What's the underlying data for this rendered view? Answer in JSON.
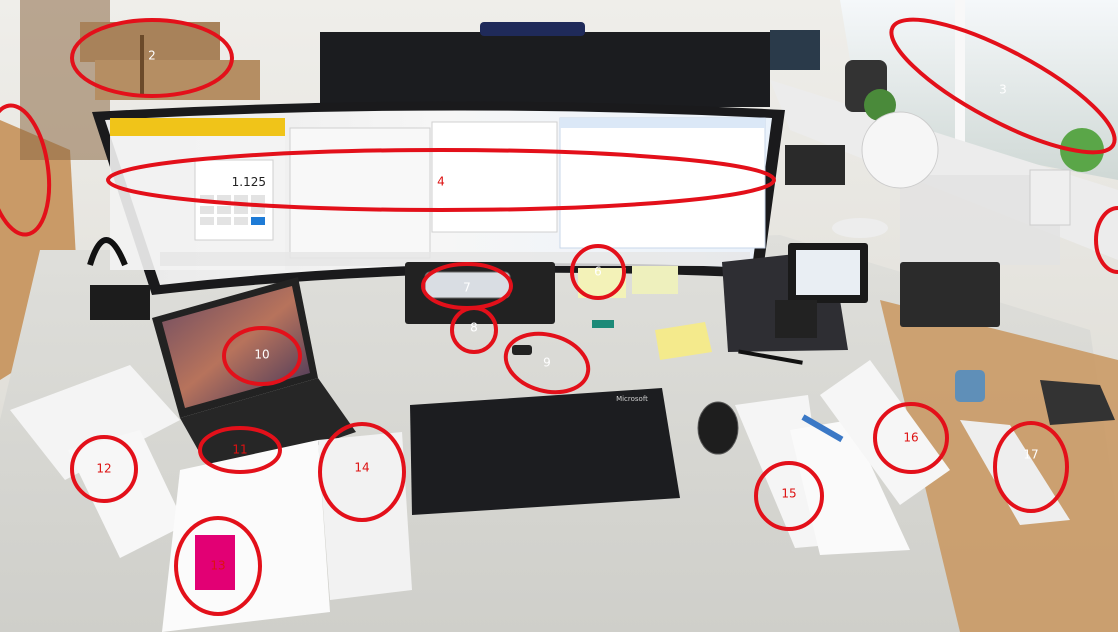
{
  "markers": [
    {
      "id": "marker-2",
      "label": "2"
    },
    {
      "id": "marker-3",
      "label": "3"
    },
    {
      "id": "marker-4",
      "label": "4"
    },
    {
      "id": "marker-6",
      "label": "6"
    },
    {
      "id": "marker-7",
      "label": "7"
    },
    {
      "id": "marker-8",
      "label": "8"
    },
    {
      "id": "marker-9",
      "label": "9"
    },
    {
      "id": "marker-10",
      "label": "10"
    },
    {
      "id": "marker-11",
      "label": "11"
    },
    {
      "id": "marker-12",
      "label": "12"
    },
    {
      "id": "marker-13",
      "label": "13"
    },
    {
      "id": "marker-14",
      "label": "14"
    },
    {
      "id": "marker-15",
      "label": "15"
    },
    {
      "id": "marker-16",
      "label": "16"
    },
    {
      "id": "marker-17",
      "label": "17"
    }
  ],
  "screen": {
    "calculator_value": "1.125"
  },
  "keyboard": {
    "brand": "Microsoft"
  },
  "colors": {
    "marker": "#e3101a",
    "desk": "#d7d7d2",
    "wall": "#ecebe6",
    "floor": "#c99a67",
    "keyboard": "#1c1d20"
  }
}
